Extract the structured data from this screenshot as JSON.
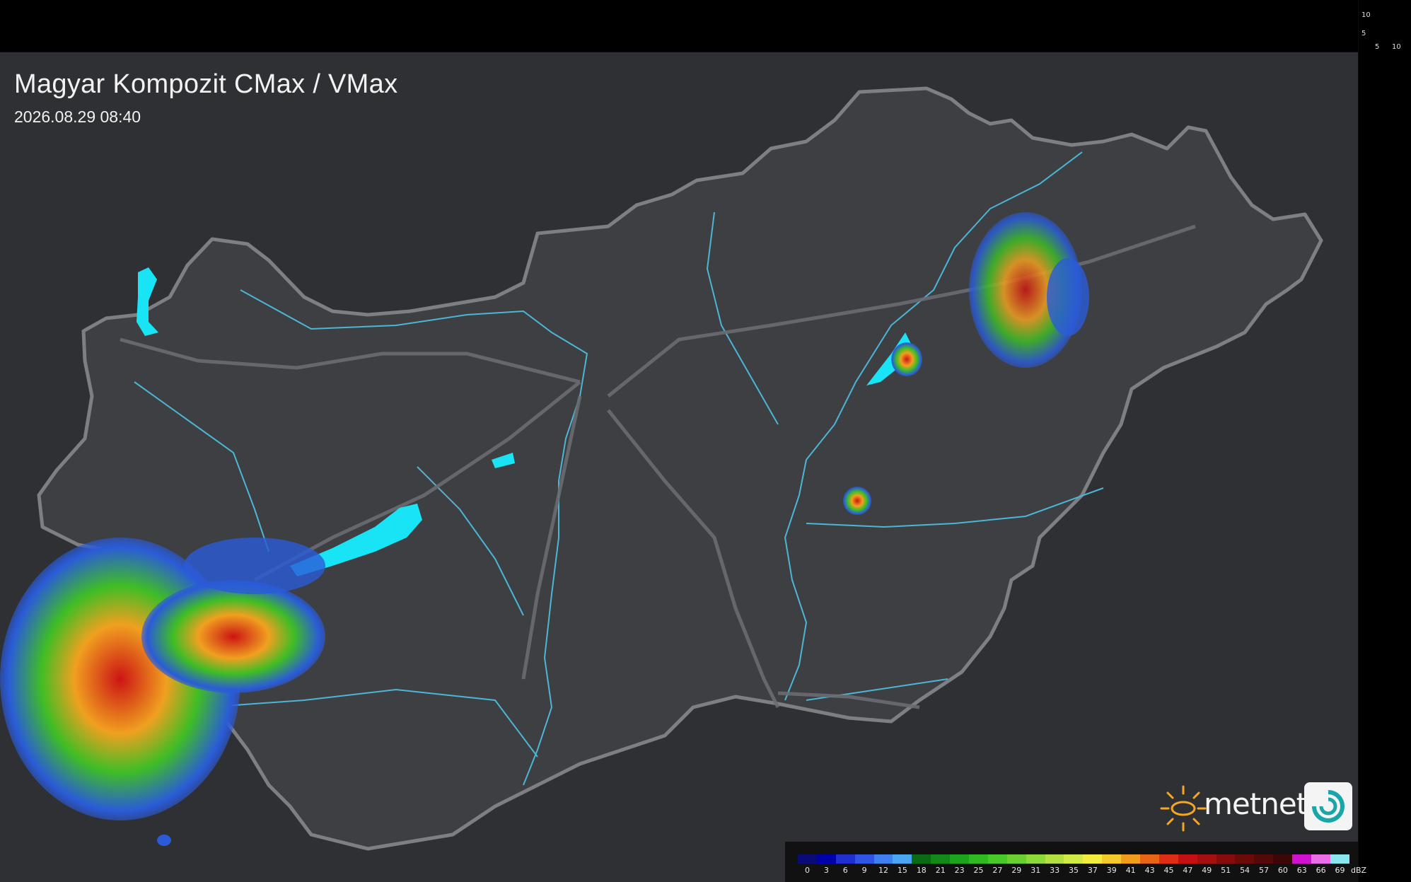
{
  "map": {
    "title": "Magyar Kompozit CMax / VMax",
    "timestamp": "2026.08.29 08:40",
    "country": "Hungary",
    "legend": {
      "unit": "dBZ",
      "values": [
        "0",
        "3",
        "6",
        "9",
        "12",
        "15",
        "18",
        "21",
        "23",
        "25",
        "27",
        "29",
        "31",
        "33",
        "35",
        "37",
        "39",
        "41",
        "43",
        "45",
        "47",
        "49",
        "51",
        "54",
        "57",
        "60",
        "63",
        "66",
        "69"
      ],
      "colors": [
        "#0a0a78",
        "#0000aa",
        "#1f2fd0",
        "#2e55e6",
        "#3e80f0",
        "#4aa6f2",
        "#0a6b12",
        "#138a18",
        "#1ea31c",
        "#2fba22",
        "#49c82a",
        "#6ad031",
        "#8fd83a",
        "#b3e040",
        "#d2ea46",
        "#f2ec3f",
        "#f3c92c",
        "#f19c1d",
        "#ea6415",
        "#de2d12",
        "#c41010",
        "#a40f10",
        "#860c0c",
        "#6c0a0a",
        "#540808",
        "#3e0606",
        "#d011d0",
        "#e86fe8",
        "#8ae6ee"
      ]
    },
    "side_ticks": [
      "10",
      "5",
      "5",
      "10"
    ],
    "brand": "metnet",
    "colors": {
      "background": "#2f3033",
      "border": "#7d7f84",
      "rivers": "#4bb6d6",
      "lakes": "#19e4f5"
    }
  }
}
